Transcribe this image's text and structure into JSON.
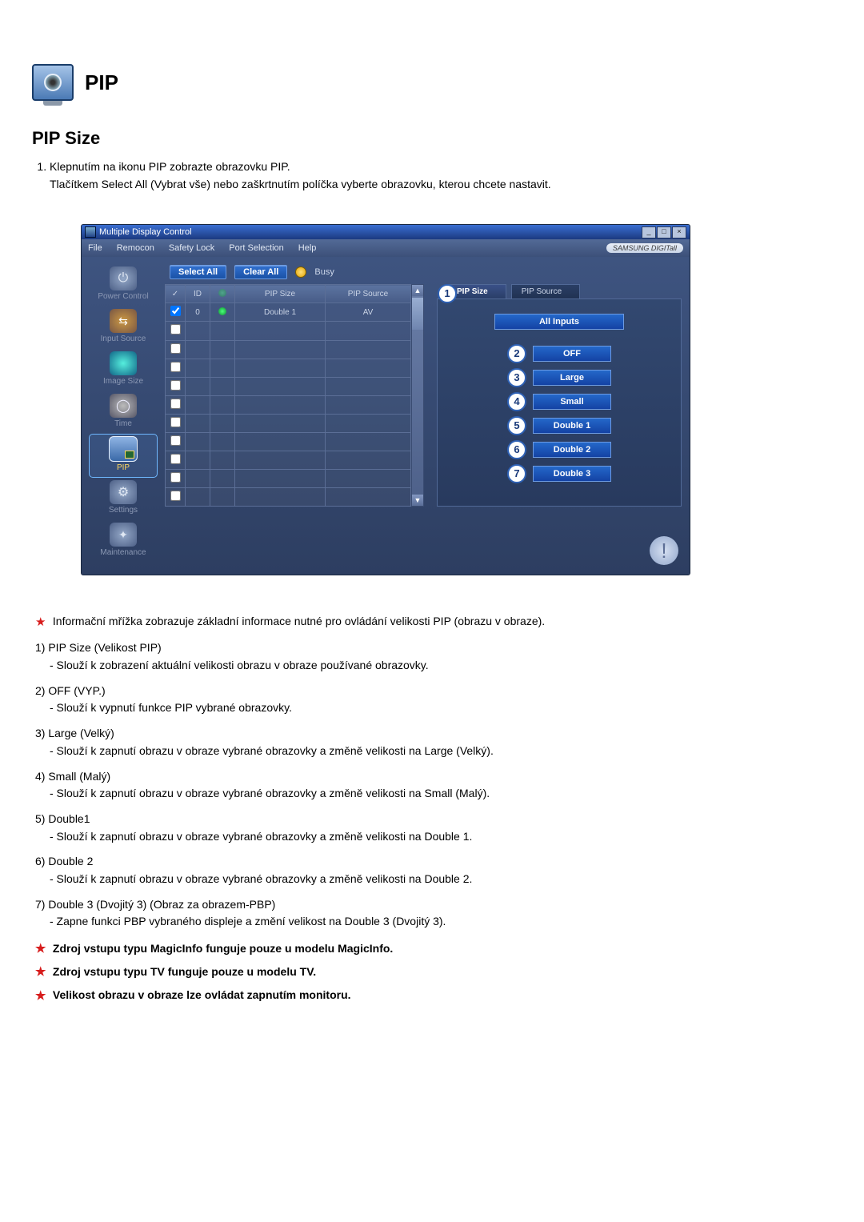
{
  "header": {
    "title": "PIP"
  },
  "section_title": "PIP Size",
  "instructions": [
    "Klepnutím na ikonu PIP zobrazte obrazovku PIP.",
    "Tlačítkem Select All (Vybrat vše) nebo zaškrtnutím políčka vyberte obrazovku, kterou chcete nastavit."
  ],
  "app": {
    "title": "Multiple Display Control",
    "brand": "SAMSUNG DIGITall",
    "menus": [
      "File",
      "Remocon",
      "Safety Lock",
      "Port Selection",
      "Help"
    ],
    "sidebar": [
      {
        "label": "Power Control",
        "icon": "power"
      },
      {
        "label": "Input Source",
        "icon": "input"
      },
      {
        "label": "Image Size",
        "icon": "image"
      },
      {
        "label": "Time",
        "icon": "time"
      },
      {
        "label": "PIP",
        "icon": "pip",
        "active": true
      },
      {
        "label": "Settings",
        "icon": "settings"
      },
      {
        "label": "Maintenance",
        "icon": "maint"
      }
    ],
    "toolbar": {
      "select_all": "Select All",
      "clear_all": "Clear All",
      "busy": "Busy"
    },
    "grid": {
      "headers": {
        "check": "✓",
        "id": "ID",
        "status": "",
        "pip_size": "PIP Size",
        "pip_source": "PIP Source"
      },
      "rows": [
        {
          "checked": true,
          "id": "0",
          "status": "on",
          "pip_size": "Double 1",
          "pip_source": "AV"
        },
        {
          "checked": false,
          "id": "",
          "status": "",
          "pip_size": "",
          "pip_source": ""
        },
        {
          "checked": false,
          "id": "",
          "status": "",
          "pip_size": "",
          "pip_source": ""
        },
        {
          "checked": false,
          "id": "",
          "status": "",
          "pip_size": "",
          "pip_source": ""
        },
        {
          "checked": false,
          "id": "",
          "status": "",
          "pip_size": "",
          "pip_source": ""
        },
        {
          "checked": false,
          "id": "",
          "status": "",
          "pip_size": "",
          "pip_source": ""
        },
        {
          "checked": false,
          "id": "",
          "status": "",
          "pip_size": "",
          "pip_source": ""
        },
        {
          "checked": false,
          "id": "",
          "status": "",
          "pip_size": "",
          "pip_source": ""
        },
        {
          "checked": false,
          "id": "",
          "status": "",
          "pip_size": "",
          "pip_source": ""
        },
        {
          "checked": false,
          "id": "",
          "status": "",
          "pip_size": "",
          "pip_source": ""
        },
        {
          "checked": false,
          "id": "",
          "status": "",
          "pip_size": "",
          "pip_source": ""
        }
      ]
    },
    "tabs": {
      "pip_size": {
        "label": "PIP Size",
        "badge": "1"
      },
      "pip_source": {
        "label": "PIP Source"
      }
    },
    "panel": {
      "all_inputs": "All Inputs",
      "options": [
        {
          "n": "2",
          "label": "OFF"
        },
        {
          "n": "3",
          "label": "Large"
        },
        {
          "n": "4",
          "label": "Small"
        },
        {
          "n": "5",
          "label": "Double 1"
        },
        {
          "n": "6",
          "label": "Double 2"
        },
        {
          "n": "7",
          "label": "Double 3"
        }
      ]
    }
  },
  "below": {
    "intro": "Informační mřížka zobrazuje základní informace nutné pro ovládání velikosti PIP (obrazu v obraze).",
    "items": [
      {
        "n": "1)",
        "title": "PIP Size (Velikost PIP)",
        "desc": "- Slouží k zobrazení aktuální velikosti obrazu v obraze používané obrazovky."
      },
      {
        "n": "2)",
        "title": "OFF (VYP.)",
        "desc": "- Slouží k vypnutí funkce PIP vybrané obrazovky."
      },
      {
        "n": "3)",
        "title": "Large (Velký)",
        "desc": "- Slouží k zapnutí obrazu v obraze vybrané obrazovky a změně velikosti na Large (Velký)."
      },
      {
        "n": "4)",
        "title": "Small (Malý)",
        "desc": "- Slouží k zapnutí obrazu v obraze vybrané obrazovky a změně velikosti na Small (Malý)."
      },
      {
        "n": "5)",
        "title": "Double1",
        "desc": "- Slouží k zapnutí obrazu v obraze vybrané obrazovky a změně velikosti na Double 1."
      },
      {
        "n": "6)",
        "title": "Double 2",
        "desc": "- Slouží k zapnutí obrazu v obraze vybrané obrazovky a změně velikosti na Double 2."
      },
      {
        "n": "7)",
        "title": "Double 3 (Dvojitý 3) (Obraz za obrazem-PBP)",
        "desc": "- Zapne funkci PBP vybraného displeje a změní velikost na Double 3 (Dvojitý 3)."
      }
    ],
    "bold_notes": [
      "Zdroj vstupu typu MagicInfo funguje pouze u modelu MagicInfo.",
      "Zdroj vstupu typu TV funguje pouze u modelu TV.",
      "Velikost obrazu v obraze lze ovládat zapnutím monitoru."
    ]
  }
}
